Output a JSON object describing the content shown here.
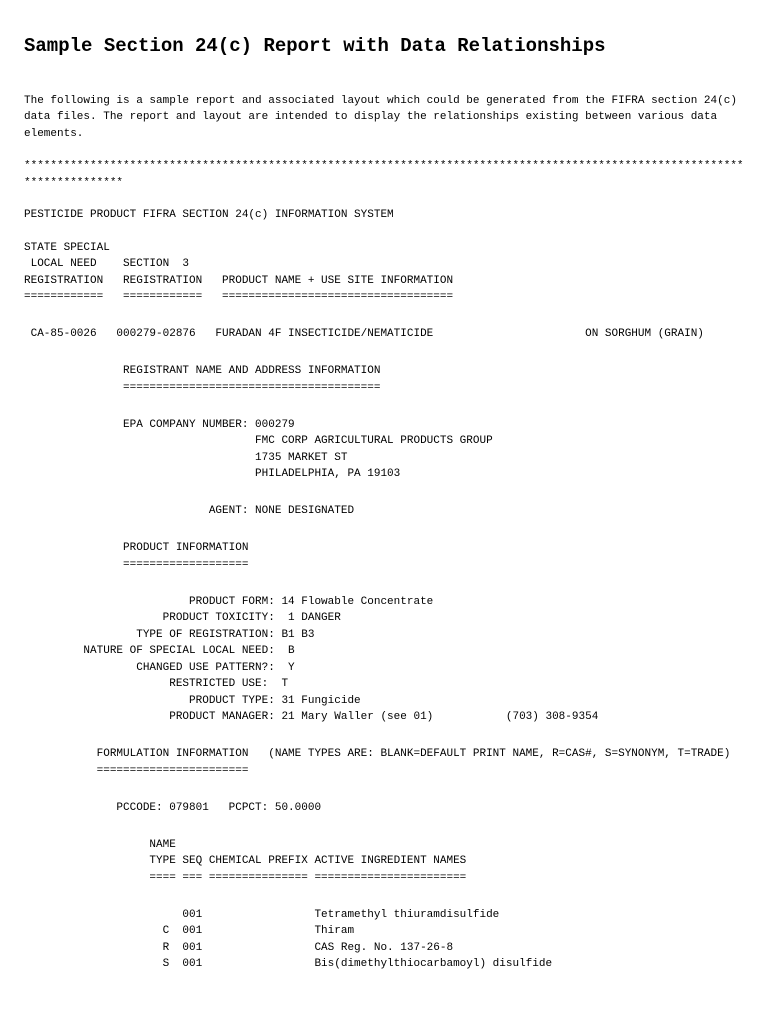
{
  "title": "Sample Section 24(c) Report with Data Relationships",
  "intro": "The following is a sample report and associated layout which could be generated from the FIFRA section 24(c) data files. The report and layout are intended to display the relationships existing between various data elements.",
  "divider": "****************************************************************************************************************************",
  "system_title": "PESTICIDE PRODUCT FIFRA SECTION 24(c) INFORMATION SYSTEM",
  "header_block": "STATE SPECIAL\n LOCAL NEED    SECTION  3\nREGISTRATION   REGISTRATION   PRODUCT NAME + USE SITE INFORMATION\n============   ============   ===================================",
  "data_row": " CA-85-0026   000279-02876   FURADAN 4F INSECTICIDE/NEMATICIDE                       ON SORGHUM (GRAIN)",
  "registrant_header": "               REGISTRANT NAME AND ADDRESS INFORMATION\n               =======================================",
  "registrant_info": "               EPA COMPANY NUMBER: 000279\n                                   FMC CORP AGRICULTURAL PRODUCTS GROUP\n                                   1735 MARKET ST\n                                   PHILADELPHIA, PA 19103",
  "agent_info": "                            AGENT: NONE DESIGNATED",
  "product_header": "               PRODUCT INFORMATION\n               ===================",
  "product_info": "                         PRODUCT FORM: 14 Flowable Concentrate\n                     PRODUCT TOXICITY:  1 DANGER\n                 TYPE OF REGISTRATION: B1 B3\n         NATURE OF SPECIAL LOCAL NEED:  B\n                 CHANGED USE PATTERN?:  Y\n                      RESTRICTED USE:  T\n                         PRODUCT TYPE: 31 Fungicide\n                      PRODUCT MANAGER: 21 Mary Waller (see 01)           (703) 308-9354",
  "formulation_header": "           FORMULATION INFORMATION   (NAME TYPES ARE: BLANK=DEFAULT PRINT NAME, R=CAS#, S=SYNONYM, T=TRADE)\n           =======================",
  "pccode_line": "              PCCODE: 079801   PCPCT: 50.0000",
  "ingredients_header": "                   NAME\n                   TYPE SEQ CHEMICAL PREFIX ACTIVE INGREDIENT NAMES\n                   ==== === =============== =======================",
  "ingredients_list": "                        001                 Tetramethyl thiuramdisulfide\n                     C  001                 Thiram\n                     R  001                 CAS Reg. No. 137-26-8\n                     S  001                 Bis(dimethylthiocarbamoyl) disulfide"
}
